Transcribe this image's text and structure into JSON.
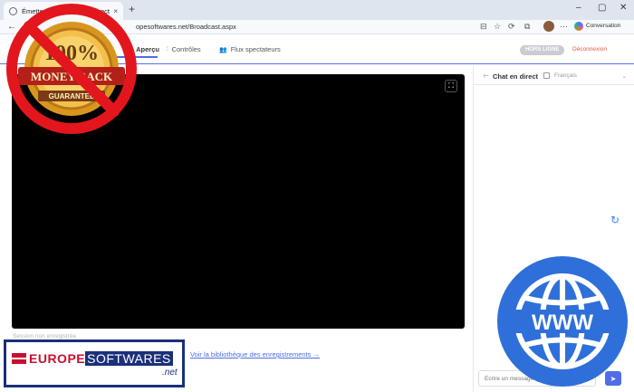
{
  "browser": {
    "tab_title": "Émetteur - Diffusion en direct",
    "tab_close": "×",
    "new_tab": "+",
    "url_visible": "opesoftwares.net/Broadcast.aspx",
    "conversation_label": "Conversation"
  },
  "app": {
    "tabs": [
      {
        "label": "Aperçu",
        "icon": "eye-icon",
        "active": true
      },
      {
        "label": "Contrôles",
        "icon": "sliders-icon",
        "active": false
      },
      {
        "label": "Flux spectateurs",
        "icon": "users-icon",
        "active": false
      }
    ],
    "status_badge": "HORS LIGNE",
    "logout": "Déconnexion",
    "session_note": "Session non enregistrée",
    "library_link": "Voir la bibliothèque des enregistrements →"
  },
  "chat": {
    "title": "Chat en direct",
    "language": "Français",
    "input_placeholder": "Écrire un message",
    "send_icon": "send-icon"
  },
  "overlays": {
    "badge_top": "100%",
    "badge_mid": "MONEY BACK",
    "badge_bottom": "GUARANTEE",
    "www": "WWW",
    "brand_eu": "EUROPE",
    "brand_sw": "SOFTWARES",
    "brand_net": ".net"
  },
  "colors": {
    "accent": "#4f6de8",
    "prohibition_red": "#e3161e",
    "www_blue": "#2f6fd9",
    "brand_navy": "#1b2f7a",
    "brand_red": "#c8102e"
  }
}
